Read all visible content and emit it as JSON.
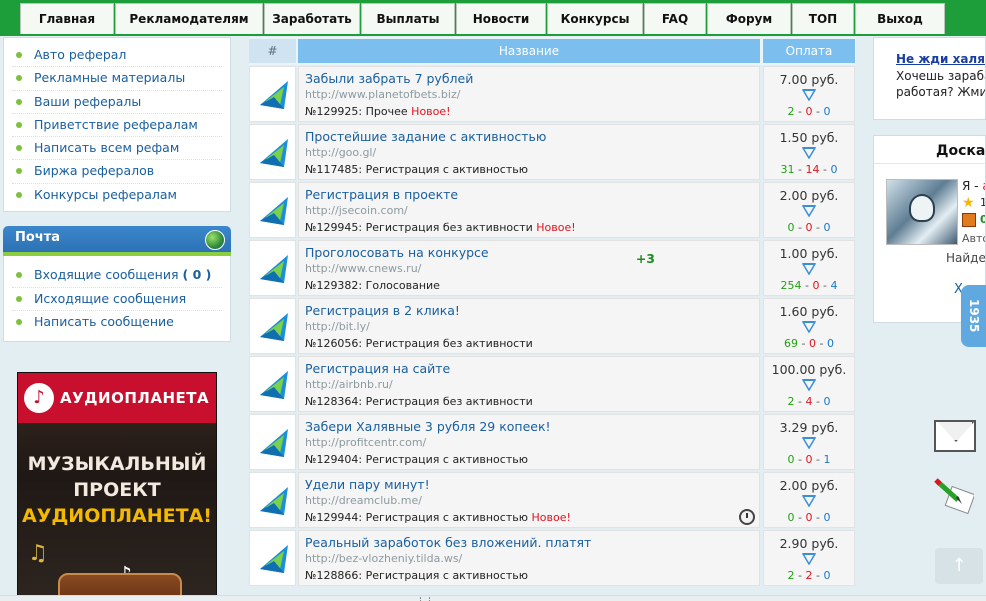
{
  "nav": [
    {
      "label": "Главная",
      "w": 0
    },
    {
      "label": "Рекламодателям"
    },
    {
      "label": "Заработать"
    },
    {
      "label": "Выплаты"
    },
    {
      "label": "Новости"
    },
    {
      "label": "Конкурсы"
    },
    {
      "label": "FAQ"
    },
    {
      "label": "Форум"
    },
    {
      "label": "ТОП"
    },
    {
      "label": "Выход"
    }
  ],
  "referrals": [
    "Авто реферал",
    "Рекламные материалы",
    "Ваши рефералы",
    "Приветствие рефералам",
    "Написать всем рефам",
    "Биржа рефералов",
    "Конкурсы рефералам"
  ],
  "mail": {
    "title": "Почта",
    "inbox_label": "Входящие сообщения",
    "inbox_count": "0",
    "outbox_label": "Исходящие сообщения",
    "write_label": "Написать сообщение"
  },
  "banner": {
    "brand": "АУДИОПЛАНЕТА",
    "line1": "МУЗЫКАЛЬНЫЙ",
    "line2": "ПРОЕКТ",
    "line3": "АУДИОПЛАНЕТА!"
  },
  "table": {
    "col_num": "#",
    "col_name": "Название",
    "col_pay": "Оплата"
  },
  "tasks": [
    {
      "title": "Забыли забрать 7 рублей",
      "url": "http://www.planetofbets.biz/",
      "id": "№129925:",
      "category": "Прочее",
      "new": "Новое!",
      "price": "7.00 руб.",
      "s1": "2",
      "s2": "0",
      "s3": "0"
    },
    {
      "title": "Простейшие задание с активностью",
      "url": "http://goo.gl/",
      "id": "№117485:",
      "category": "Регистрация с активностью",
      "new": "",
      "price": "1.50 руб.",
      "s1": "31",
      "s2": "14",
      "s3": "0"
    },
    {
      "title": "Регистрация в проекте",
      "url": "http://jsecoin.com/",
      "id": "№129945:",
      "category": "Регистрация без активности",
      "new": "Новое!",
      "price": "2.00 руб.",
      "s1": "0",
      "s2": "0",
      "s3": "0"
    },
    {
      "title": "Проголосовать на конкурсе",
      "url": "http://www.cnews.ru/",
      "id": "№129382:",
      "category": "Голосование",
      "new": "",
      "bonus": "+3",
      "price": "1.00 руб.",
      "s1": "254",
      "s2": "0",
      "s3": "4"
    },
    {
      "title": "Регистрация в 2 клика!",
      "url": "http://bit.ly/",
      "id": "№126056:",
      "category": "Регистрация без активности",
      "new": "",
      "price": "1.60 руб.",
      "s1": "69",
      "s2": "0",
      "s3": "0"
    },
    {
      "title": "Регистрация на сайте",
      "url": "http://airbnb.ru/",
      "id": "№128364:",
      "category": "Регистрация без активности",
      "new": "",
      "price": "100.00 руб.",
      "s1": "2",
      "s2": "4",
      "s3": "0"
    },
    {
      "title": "Забери Халявные 3 рубля 29 копеек!",
      "url": "http://profitcentr.com/",
      "id": "№129404:",
      "category": "Регистрация с активностью",
      "new": "",
      "price": "3.29 руб.",
      "s1": "0",
      "s2": "0",
      "s3": "1"
    },
    {
      "title": "Удели пару минут!",
      "url": "http://dreamclub.me/",
      "id": "№129944:",
      "category": "Регистрация с активностью",
      "new": "Новое!",
      "clock": true,
      "price": "2.00 руб.",
      "s1": "0",
      "s2": "0",
      "s3": "0"
    },
    {
      "title": "Реальный заработок без вложений. платят",
      "url": "http://bez-vlozheniy.tilda.ws/",
      "id": "№128866:",
      "category": "Регистрация с активностью",
      "new": "",
      "price": "2.90 руб.",
      "s1": "2",
      "s2": "2",
      "s3": "0"
    }
  ],
  "promo": {
    "link": "Не жди халяву,",
    "line1": "Хочешь зараба",
    "line2": "работая? Жми."
  },
  "board": {
    "title": "Доска",
    "user_prefix": "Я -",
    "user_suffix": "а",
    "star_val": "1",
    "chest_val": "0",
    "auto": "Авто",
    "find": "Найдет",
    "x": "Х"
  },
  "side_tab": "1935",
  "to_top": "↑",
  "colors": {
    "nav_bg": "#1d9e3b",
    "accent": "#7cbfee",
    "link": "#1a5fa0",
    "new": "#e0141e"
  }
}
